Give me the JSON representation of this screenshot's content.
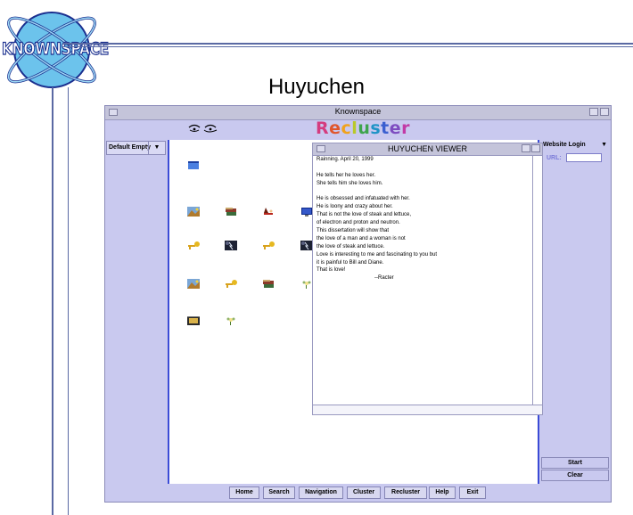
{
  "slide": {
    "logo_text": "KNOWNSPACE",
    "title": "Huyuchen"
  },
  "app": {
    "window_title": "Knownspace",
    "brand": "Recluster",
    "folder_dropdown": "Default Empty",
    "login_dropdown": "Website Login",
    "url_label": "URL:",
    "url_value": "",
    "start_label": "Start",
    "clear_label": "Clear",
    "nav": [
      "Home",
      "Search",
      "Navigation",
      "Cluster",
      "Recluster",
      "Help",
      "Exit"
    ],
    "brand_colors": [
      "#d43c7f",
      "#e0562e",
      "#f0a21d",
      "#b9c82a",
      "#3fa44d",
      "#1f93c6",
      "#3b5fd0",
      "#7d4cc0",
      "#c23aa6"
    ]
  },
  "viewer": {
    "title": "HUYUCHEN VIEWER",
    "lines": [
      "Rainning. April 20, 1999",
      "",
      "He tells her he loves her.",
      "She tells him she loves him.",
      "",
      "He is obsessed and infatuated with her.",
      "He is loony and crazy about her.",
      "That is not the love of steak and lettuce,",
      "of electron and proton and neutron.",
      "This dissertation will show that",
      "the love of a man and a woman is not",
      "the love of steak and lettuce.",
      "Love is interesting to me and fascinating to you but",
      "it is painful to Bill and Diane.",
      "That is love!"
    ],
    "signature": "--Racter"
  },
  "icons": [
    "calendar-icon",
    "landscape-icon",
    "books-icon",
    "witch-icon",
    "monitor-icon",
    "key-icon",
    "storm-icon",
    "key-icon",
    "storm-icon",
    "landscape-icon",
    "key-icon",
    "books-icon",
    "flower-icon",
    "film-icon",
    "flower-icon"
  ]
}
